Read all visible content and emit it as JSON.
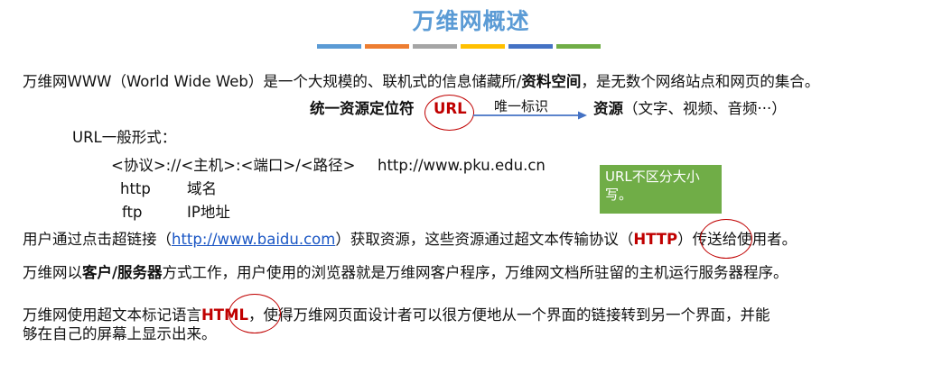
{
  "title": "万维网概述",
  "colors": {
    "title": "#5b9bd5",
    "bars": [
      "#5b9bd5",
      "#ed7d31",
      "#a5a5a5",
      "#ffc000",
      "#4472c4",
      "#70ad47"
    ],
    "highlight": "#c00000",
    "note_bg": "#70ad47",
    "link": "#1a56c4"
  },
  "para1": {
    "text1": "万维网WWW（World Wide Web）是一个大规模的、联机式的信息储藏所/",
    "bold": "资料空间",
    "text2": "，是无数个网络站点和网页的集合。"
  },
  "url_line": {
    "term": "统一资源定位符",
    "acronym": "URL",
    "arrow_label": "唯一标识",
    "target_bold": "资源",
    "target_rest": "（文字、视频、音频···）"
  },
  "url_form": {
    "heading": "URL一般形式：",
    "pattern": "<协议>://<主机>:<端口>/<路径>",
    "example": "http://www.pku.edu.cn",
    "row1_a": "http",
    "row1_b": "域名",
    "row2_a": "ftp",
    "row2_b": "IP地址"
  },
  "note": "URL不区分大小写。",
  "para2": {
    "text1": "用户通过点击超链接（",
    "link": "http://www.baidu.com",
    "text2": "）获取资源，这些资源通过超文本传输协议（",
    "acronym": "HTTP",
    "text3": "）传送给使用者。"
  },
  "para3": {
    "text1": "万维网以",
    "bold": "客户/服务器",
    "text2": "方式工作，用户使用的浏览器就是万维网客户程序，万维网文档所驻留的主机运行服务器程序。"
  },
  "para4": {
    "text1": "万维网使用超文本标记语言",
    "acronym": "HTML",
    "text2": "，使得万维网页面设计者可以很方便地从一个界面的链接转到另一个界面，并能",
    "line2": "够在自己的屏幕上显示出来。"
  }
}
